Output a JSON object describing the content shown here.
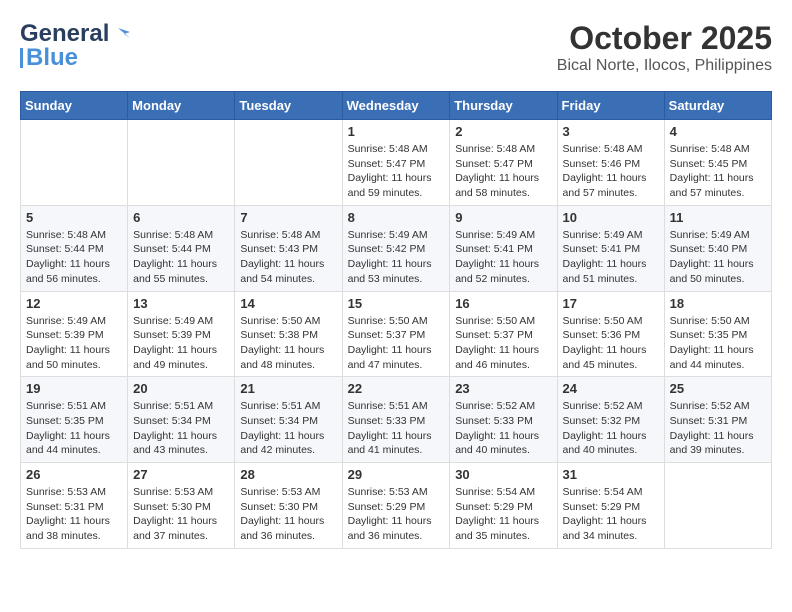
{
  "header": {
    "logo_general": "General",
    "logo_blue": "Blue",
    "month": "October 2025",
    "location": "Bical Norte, Ilocos, Philippines"
  },
  "weekdays": [
    "Sunday",
    "Monday",
    "Tuesday",
    "Wednesday",
    "Thursday",
    "Friday",
    "Saturday"
  ],
  "weeks": [
    [
      null,
      null,
      null,
      {
        "day": 1,
        "sunrise": "5:48 AM",
        "sunset": "5:47 PM",
        "daylight": "11 hours and 59 minutes."
      },
      {
        "day": 2,
        "sunrise": "5:48 AM",
        "sunset": "5:47 PM",
        "daylight": "11 hours and 58 minutes."
      },
      {
        "day": 3,
        "sunrise": "5:48 AM",
        "sunset": "5:46 PM",
        "daylight": "11 hours and 57 minutes."
      },
      {
        "day": 4,
        "sunrise": "5:48 AM",
        "sunset": "5:45 PM",
        "daylight": "11 hours and 57 minutes."
      }
    ],
    [
      {
        "day": 5,
        "sunrise": "5:48 AM",
        "sunset": "5:44 PM",
        "daylight": "11 hours and 56 minutes."
      },
      {
        "day": 6,
        "sunrise": "5:48 AM",
        "sunset": "5:44 PM",
        "daylight": "11 hours and 55 minutes."
      },
      {
        "day": 7,
        "sunrise": "5:48 AM",
        "sunset": "5:43 PM",
        "daylight": "11 hours and 54 minutes."
      },
      {
        "day": 8,
        "sunrise": "5:49 AM",
        "sunset": "5:42 PM",
        "daylight": "11 hours and 53 minutes."
      },
      {
        "day": 9,
        "sunrise": "5:49 AM",
        "sunset": "5:41 PM",
        "daylight": "11 hours and 52 minutes."
      },
      {
        "day": 10,
        "sunrise": "5:49 AM",
        "sunset": "5:41 PM",
        "daylight": "11 hours and 51 minutes."
      },
      {
        "day": 11,
        "sunrise": "5:49 AM",
        "sunset": "5:40 PM",
        "daylight": "11 hours and 50 minutes."
      }
    ],
    [
      {
        "day": 12,
        "sunrise": "5:49 AM",
        "sunset": "5:39 PM",
        "daylight": "11 hours and 50 minutes."
      },
      {
        "day": 13,
        "sunrise": "5:49 AM",
        "sunset": "5:39 PM",
        "daylight": "11 hours and 49 minutes."
      },
      {
        "day": 14,
        "sunrise": "5:50 AM",
        "sunset": "5:38 PM",
        "daylight": "11 hours and 48 minutes."
      },
      {
        "day": 15,
        "sunrise": "5:50 AM",
        "sunset": "5:37 PM",
        "daylight": "11 hours and 47 minutes."
      },
      {
        "day": 16,
        "sunrise": "5:50 AM",
        "sunset": "5:37 PM",
        "daylight": "11 hours and 46 minutes."
      },
      {
        "day": 17,
        "sunrise": "5:50 AM",
        "sunset": "5:36 PM",
        "daylight": "11 hours and 45 minutes."
      },
      {
        "day": 18,
        "sunrise": "5:50 AM",
        "sunset": "5:35 PM",
        "daylight": "11 hours and 44 minutes."
      }
    ],
    [
      {
        "day": 19,
        "sunrise": "5:51 AM",
        "sunset": "5:35 PM",
        "daylight": "11 hours and 44 minutes."
      },
      {
        "day": 20,
        "sunrise": "5:51 AM",
        "sunset": "5:34 PM",
        "daylight": "11 hours and 43 minutes."
      },
      {
        "day": 21,
        "sunrise": "5:51 AM",
        "sunset": "5:34 PM",
        "daylight": "11 hours and 42 minutes."
      },
      {
        "day": 22,
        "sunrise": "5:51 AM",
        "sunset": "5:33 PM",
        "daylight": "11 hours and 41 minutes."
      },
      {
        "day": 23,
        "sunrise": "5:52 AM",
        "sunset": "5:33 PM",
        "daylight": "11 hours and 40 minutes."
      },
      {
        "day": 24,
        "sunrise": "5:52 AM",
        "sunset": "5:32 PM",
        "daylight": "11 hours and 40 minutes."
      },
      {
        "day": 25,
        "sunrise": "5:52 AM",
        "sunset": "5:31 PM",
        "daylight": "11 hours and 39 minutes."
      }
    ],
    [
      {
        "day": 26,
        "sunrise": "5:53 AM",
        "sunset": "5:31 PM",
        "daylight": "11 hours and 38 minutes."
      },
      {
        "day": 27,
        "sunrise": "5:53 AM",
        "sunset": "5:30 PM",
        "daylight": "11 hours and 37 minutes."
      },
      {
        "day": 28,
        "sunrise": "5:53 AM",
        "sunset": "5:30 PM",
        "daylight": "11 hours and 36 minutes."
      },
      {
        "day": 29,
        "sunrise": "5:53 AM",
        "sunset": "5:29 PM",
        "daylight": "11 hours and 36 minutes."
      },
      {
        "day": 30,
        "sunrise": "5:54 AM",
        "sunset": "5:29 PM",
        "daylight": "11 hours and 35 minutes."
      },
      {
        "day": 31,
        "sunrise": "5:54 AM",
        "sunset": "5:29 PM",
        "daylight": "11 hours and 34 minutes."
      },
      null
    ]
  ]
}
